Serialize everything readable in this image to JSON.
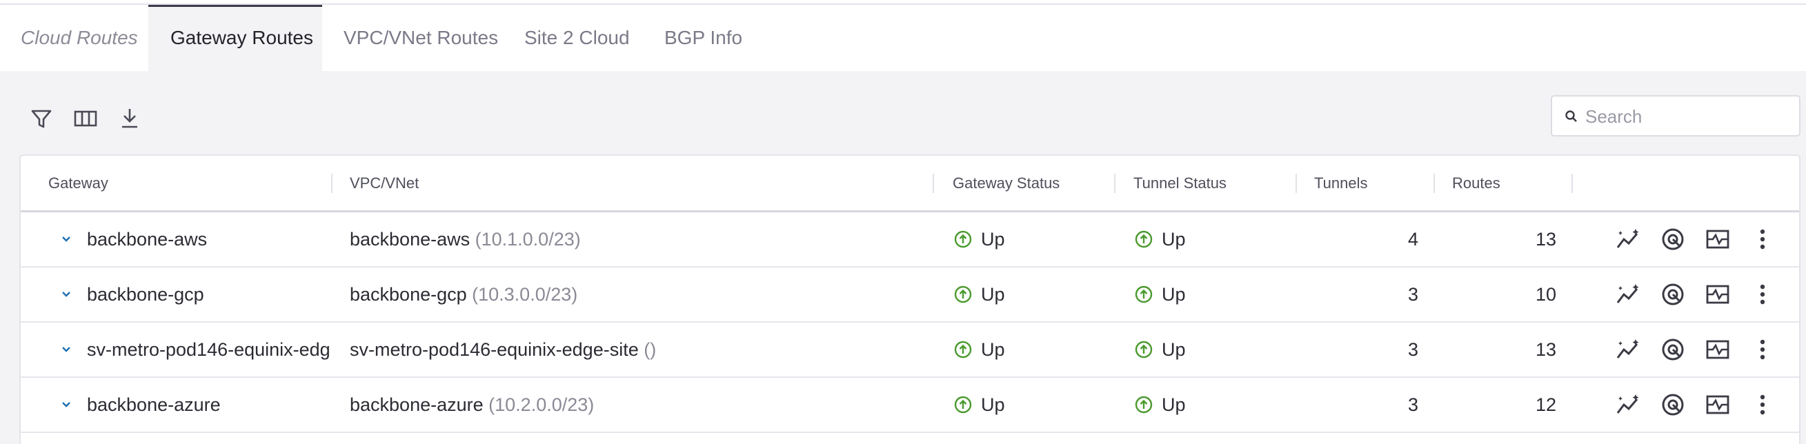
{
  "tabs": [
    {
      "label": "Cloud Routes",
      "state": "italic"
    },
    {
      "label": "Gateway Routes",
      "state": "active"
    },
    {
      "label": "VPC/VNet Routes",
      "state": "normal"
    },
    {
      "label": "Site 2 Cloud",
      "state": "normal"
    },
    {
      "label": "BGP Info",
      "state": "normal"
    }
  ],
  "toolbar": {
    "icons": [
      "filter-icon",
      "columns-icon",
      "download-icon"
    ]
  },
  "search": {
    "placeholder": "Search",
    "value": ""
  },
  "table": {
    "columns": [
      "Gateway",
      "VPC/VNet",
      "Gateway Status",
      "Tunnel Status",
      "Tunnels",
      "Routes"
    ],
    "rows": [
      {
        "gateway": "backbone-aws",
        "vpc_name": "backbone-aws",
        "vpc_cidr": "(10.1.0.0/23)",
        "gateway_status": "Up",
        "tunnel_status": "Up",
        "tunnels": "4",
        "routes": "13"
      },
      {
        "gateway": "backbone-gcp",
        "vpc_name": "backbone-gcp",
        "vpc_cidr": "(10.3.0.0/23)",
        "gateway_status": "Up",
        "tunnel_status": "Up",
        "tunnels": "3",
        "routes": "10"
      },
      {
        "gateway": "sv-metro-pod146-equinix-edg",
        "vpc_name": "sv-metro-pod146-equinix-edge-site",
        "vpc_cidr": "()",
        "gateway_status": "Up",
        "tunnel_status": "Up",
        "tunnels": "3",
        "routes": "13"
      },
      {
        "gateway": "backbone-azure",
        "vpc_name": "backbone-azure",
        "vpc_cidr": "(10.2.0.0/23)",
        "gateway_status": "Up",
        "tunnel_status": "Up",
        "tunnels": "3",
        "routes": "12"
      }
    ],
    "row_actions": [
      "sparkline-icon",
      "target-icon",
      "pulse-chart-icon",
      "kebab-menu-icon"
    ]
  },
  "colors": {
    "status_up": "#4a9a2e",
    "chevron": "#1f6fb0",
    "active_tab_border": "#3b3b48"
  }
}
